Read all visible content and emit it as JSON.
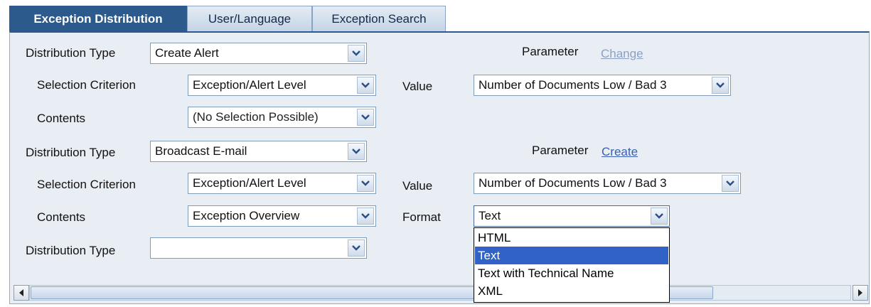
{
  "tabs": [
    {
      "label": "Exception Distribution",
      "active": true
    },
    {
      "label": "User/Language",
      "active": false
    },
    {
      "label": "Exception Search",
      "active": false
    }
  ],
  "block1": {
    "distribution_type_label": "Distribution Type",
    "distribution_type_value": "Create Alert",
    "parameter_label": "Parameter",
    "parameter_link": "Change",
    "selection_criterion_label": "Selection Criterion",
    "selection_criterion_value": "Exception/Alert Level",
    "value_label": "Value",
    "value_value": "Number of Documents Low / Bad 3",
    "contents_label": "Contents",
    "contents_value": "(No Selection Possible)"
  },
  "block2": {
    "distribution_type_label": "Distribution Type",
    "distribution_type_value": "Broadcast E-mail",
    "parameter_label": "Parameter",
    "parameter_link": "Create",
    "selection_criterion_label": "Selection Criterion",
    "selection_criterion_value": "Exception/Alert Level",
    "value_label": "Value",
    "value_value": "Number of Documents Low / Bad 3",
    "contents_label": "Contents",
    "contents_value": "Exception Overview",
    "format_label": "Format",
    "format_value": "Text"
  },
  "block3": {
    "distribution_type_label": "Distribution Type",
    "distribution_type_value": ""
  },
  "format_dropdown": {
    "options": [
      "HTML",
      "Text",
      "Text with Technical Name",
      "XML"
    ],
    "selected": "Text"
  },
  "colors": {
    "active_tab": "#2c5a8c",
    "panel_bg": "#e9eef4",
    "link": "#3a5fb5",
    "highlight": "#3163c6"
  },
  "icons": {
    "dropdown": "chevron-down-icon",
    "scroll_left": "arrow-left-icon",
    "scroll_right": "arrow-right-icon"
  }
}
